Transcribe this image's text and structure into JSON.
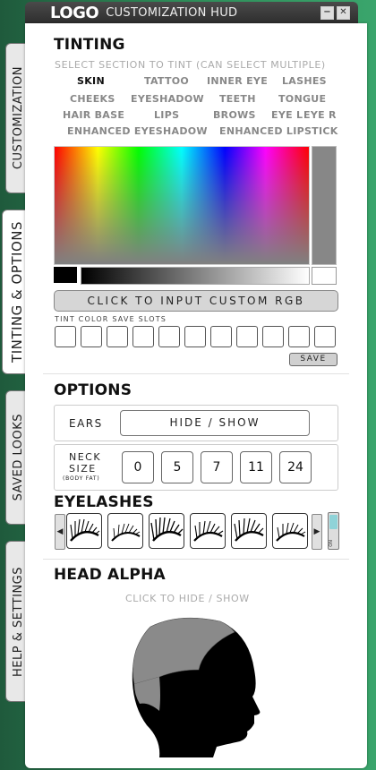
{
  "window": {
    "logo": "LOGO",
    "title": "CUSTOMIZATION HUD",
    "minimize": "−",
    "close": "✕"
  },
  "tabs": [
    {
      "label": "CUSTOMIZATION",
      "active": false
    },
    {
      "label": "TINTING & OPTIONS",
      "active": true
    },
    {
      "label": "SAVED LOOKS",
      "active": false
    },
    {
      "label": "HELP & SETTINGS",
      "active": false
    }
  ],
  "tinting": {
    "title": "TINTING",
    "hint": "SELECT SECTION TO TINT (CAN SELECT MULTIPLE)",
    "sections": [
      {
        "label": "SKIN",
        "selected": true
      },
      {
        "label": "TATTOO",
        "selected": false
      },
      {
        "label": "INNER EYE",
        "selected": false
      },
      {
        "label": "LASHES",
        "selected": false
      },
      {
        "label": "CHEEKS",
        "selected": false
      },
      {
        "label": "EYESHADOW",
        "selected": false
      },
      {
        "label": "TEETH",
        "selected": false
      },
      {
        "label": "TONGUE",
        "selected": false
      },
      {
        "label": "HAIR BASE",
        "selected": false
      },
      {
        "label": "LIPS",
        "selected": false
      },
      {
        "label": "BROWS",
        "selected": false
      },
      {
        "label": "EYE L",
        "selected": false
      },
      {
        "label": "EYE R",
        "selected": false
      },
      {
        "label": "ENHANCED EYESHADOW",
        "selected": false
      },
      {
        "label": "ENHANCED LIPSTICK",
        "selected": false
      }
    ],
    "rgb_button": "CLICK TO INPUT CUSTOM RGB",
    "save_slots_label": "TINT COLOR SAVE SLOTS",
    "save_slot_count": 11,
    "save_button": "SAVE"
  },
  "options": {
    "title": "OPTIONS",
    "ears_label": "EARS",
    "ears_button": "HIDE / SHOW",
    "neck_label": "NECK",
    "size_label": "SIZE",
    "neck_sublabel": "(BODY FAT)",
    "neck_values": [
      "0",
      "5",
      "7",
      "11",
      "24"
    ]
  },
  "eyelashes": {
    "title": "EYELASHES",
    "prev": "◀",
    "next": "▶",
    "style_count": 6,
    "toggle_label": "ON"
  },
  "head_alpha": {
    "title": "HEAD ALPHA",
    "hint": "CLICK TO HIDE / SHOW"
  },
  "colors": {
    "panel_bg": "#ffffff",
    "head_black": "#000000",
    "head_gray": "#8a8a8a",
    "toggle_on": "#8fd3d8"
  }
}
